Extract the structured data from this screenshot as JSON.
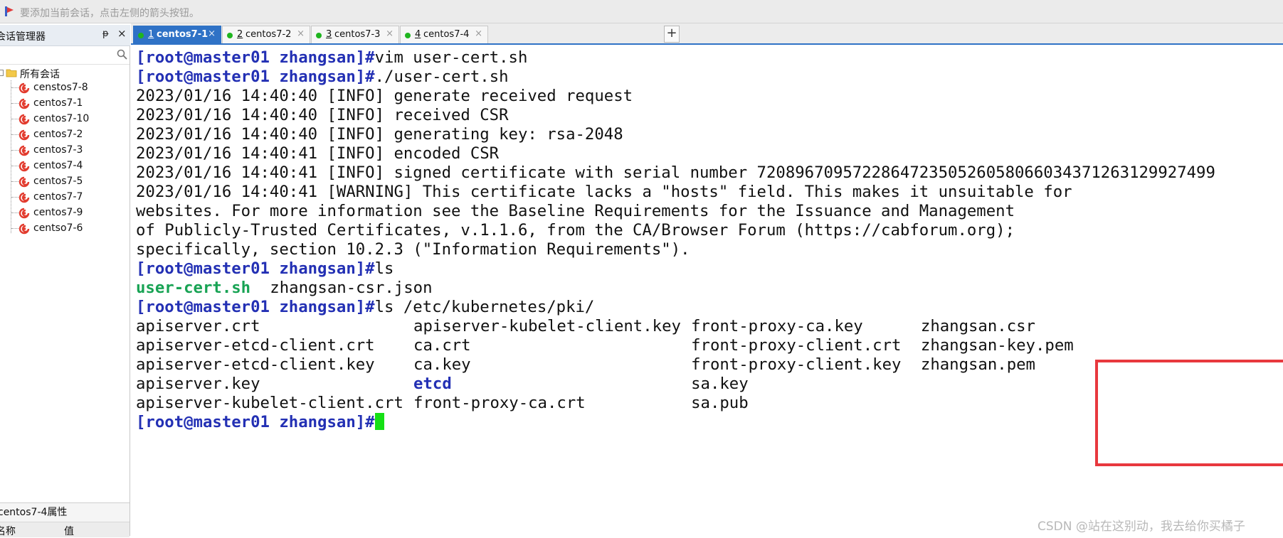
{
  "hint_bar": {
    "text": "要添加当前会话，点击左侧的箭头按钮。",
    "icon": "arrow-flag-icon"
  },
  "sidebar": {
    "title": "会话管理器",
    "pin_glyph": "ᵽ",
    "close_glyph": "×",
    "root_label": "所有会话",
    "sessions": [
      "censtos7-8",
      "centos7-1",
      "centos7-10",
      "centos7-2",
      "centos7-3",
      "centos7-4",
      "centos7-5",
      "centos7-7",
      "centos7-9",
      "centso7-6"
    ],
    "properties_title": "centos7-4属性",
    "properties_columns": [
      "名称",
      "值"
    ]
  },
  "tabs": [
    {
      "num": "1",
      "name": "centos7-1",
      "active": true
    },
    {
      "num": "2",
      "name": "centos7-2",
      "active": false
    },
    {
      "num": "3",
      "name": "centos7-3",
      "active": false
    },
    {
      "num": "4",
      "name": "centos7-4",
      "active": false
    }
  ],
  "tab_close_glyph": "×",
  "tab_add_glyph": "+",
  "colors": {
    "accent": "#2f72c6",
    "prompt": "#2330b4",
    "executable": "#18a354",
    "cursor": "#15e015",
    "highlight_box": "#e8383e",
    "status_dot": "#1fb51f"
  },
  "terminal": {
    "prompt": "[root@master01 zhangsan]#",
    "lines": [
      {
        "type": "cmd",
        "text": "vim user-cert.sh"
      },
      {
        "type": "cmd",
        "text": "./user-cert.sh"
      },
      {
        "type": "out",
        "text": "2023/01/16 14:40:40 [INFO] generate received request"
      },
      {
        "type": "out",
        "text": "2023/01/16 14:40:40 [INFO] received CSR"
      },
      {
        "type": "out",
        "text": "2023/01/16 14:40:40 [INFO] generating key: rsa-2048"
      },
      {
        "type": "out",
        "text": "2023/01/16 14:40:41 [INFO] encoded CSR"
      },
      {
        "type": "out",
        "text": "2023/01/16 14:40:41 [INFO] signed certificate with serial number 720896709572286472350526058066034371263129927499"
      },
      {
        "type": "out",
        "text": "2023/01/16 14:40:41 [WARNING] This certificate lacks a \"hosts\" field. This makes it unsuitable for"
      },
      {
        "type": "out",
        "text": "websites. For more information see the Baseline Requirements for the Issuance and Management"
      },
      {
        "type": "out",
        "text": "of Publicly-Trusted Certificates, v.1.1.6, from the CA/Browser Forum (https://cabforum.org);"
      },
      {
        "type": "out",
        "text": "specifically, section 10.2.3 (\"Information Requirements\")."
      },
      {
        "type": "cmd",
        "text": "ls"
      }
    ],
    "ls1": {
      "exec": "user-cert.sh",
      "plain": "zhangsan-csr.json"
    },
    "cmd_pki": "ls /etc/kubernetes/pki/",
    "pki_columns": [
      [
        "apiserver.crt",
        "apiserver-etcd-client.crt",
        "apiserver-etcd-client.key",
        "apiserver.key",
        "apiserver-kubelet-client.crt"
      ],
      [
        "apiserver-kubelet-client.key",
        "ca.crt",
        "ca.key",
        "etcd",
        "front-proxy-ca.crt"
      ],
      [
        "front-proxy-ca.key",
        "front-proxy-client.crt",
        "front-proxy-client.key",
        "sa.key",
        "sa.pub"
      ],
      [
        "zhangsan.csr",
        "zhangsan-key.pem",
        "zhangsan.pem"
      ]
    ]
  },
  "watermark": "CSDN @站在这别动，我去给你买橘子"
}
